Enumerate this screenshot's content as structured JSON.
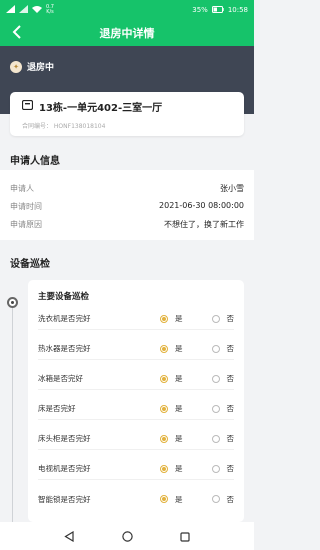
{
  "status_bar": {
    "speed_value": "0.7",
    "speed_unit": "K/s",
    "battery": "35%",
    "time": "10:58"
  },
  "header": {
    "title": "退房中详情"
  },
  "status": {
    "label": "退房中",
    "icon": "status-badge-icon"
  },
  "contract": {
    "title": "13栋-一单元402-三室一厅",
    "number": "合同编号： HONF138018104"
  },
  "applicant": {
    "section_title": "申请人信息",
    "rows": [
      {
        "label": "申请人",
        "value": "张小雪"
      },
      {
        "label": "申请时间",
        "value": "2021-06-30 08:00:00"
      },
      {
        "label": "申请原因",
        "value": "不想住了，换了新工作"
      }
    ]
  },
  "inspection": {
    "section_title": "设备巡检",
    "subtitle": "主要设备巡检",
    "yes_label": "是",
    "no_label": "否",
    "items": [
      {
        "label": "洗衣机是否完好",
        "selected": "yes"
      },
      {
        "label": "热水器是否完好",
        "selected": "yes"
      },
      {
        "label": "冰箱是否完好",
        "selected": "yes"
      },
      {
        "label": "床是否完好",
        "selected": "yes"
      },
      {
        "label": "床头柜是否完好",
        "selected": "yes"
      },
      {
        "label": "电视机是否完好",
        "selected": "yes"
      },
      {
        "label": "智能锁是否完好",
        "selected": "yes"
      }
    ]
  },
  "colors": {
    "brand": "#16c36a",
    "band": "#3f4654",
    "radio_selected": "#e2b23e"
  }
}
